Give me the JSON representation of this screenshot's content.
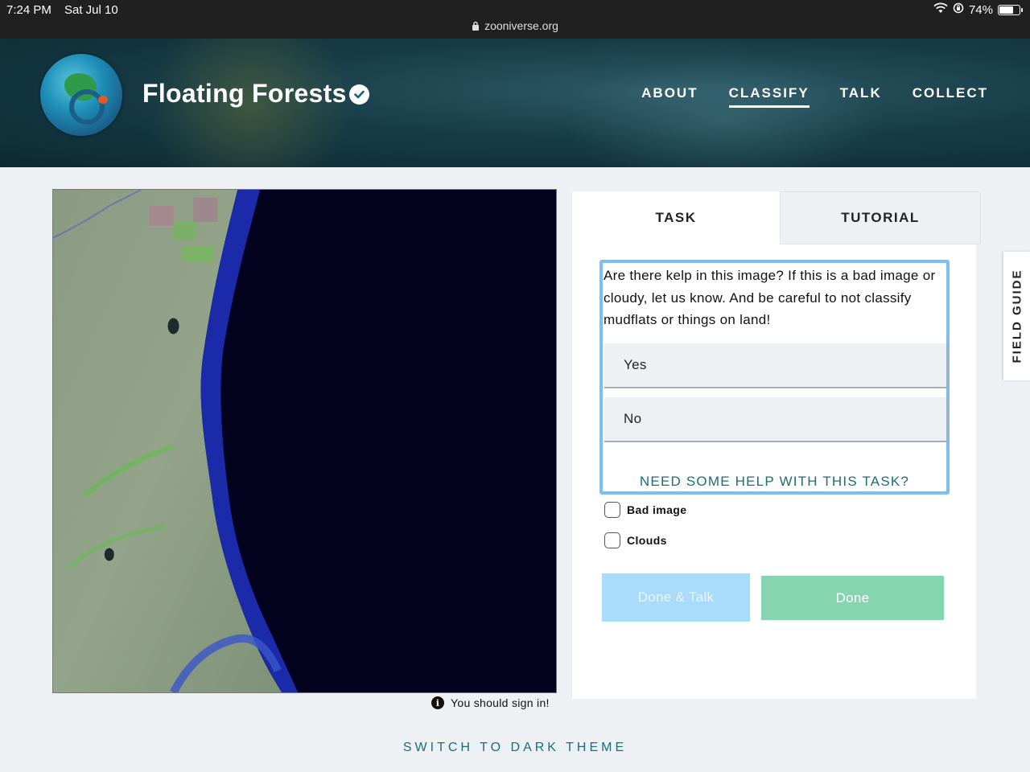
{
  "status_bar": {
    "time": "7:24 PM",
    "date": "Sat Jul 10",
    "url": "zooniverse.org",
    "battery": "74%",
    "battery_level": 0.74
  },
  "header": {
    "title": "Floating Forests",
    "nav": [
      "ABOUT",
      "CLASSIFY",
      "TALK",
      "COLLECT"
    ],
    "active_nav": "CLASSIFY"
  },
  "subject": {
    "sign_in_note": "You should sign in!"
  },
  "task_panel": {
    "tabs": [
      "TASK",
      "TUTORIAL"
    ],
    "question": "Are there kelp in this image? If this is a bad image or cloudy, let us know. And be careful to not classify mudflats or things on land!",
    "answers": [
      "Yes",
      "No"
    ],
    "help_link": "NEED SOME HELP WITH THIS TASK?",
    "checkboxes": [
      "Bad image",
      "Clouds"
    ],
    "done_talk_label": "Done & Talk",
    "done_label": "Done"
  },
  "field_guide_label": "FIELD GUIDE",
  "dark_theme_label": "SWITCH TO DARK THEME",
  "colors": {
    "accent_teal": "#1c6c7a",
    "task_border": "#7dbef5",
    "done_button": "#84d5b0",
    "done_talk_button": "#a9dbfa"
  }
}
